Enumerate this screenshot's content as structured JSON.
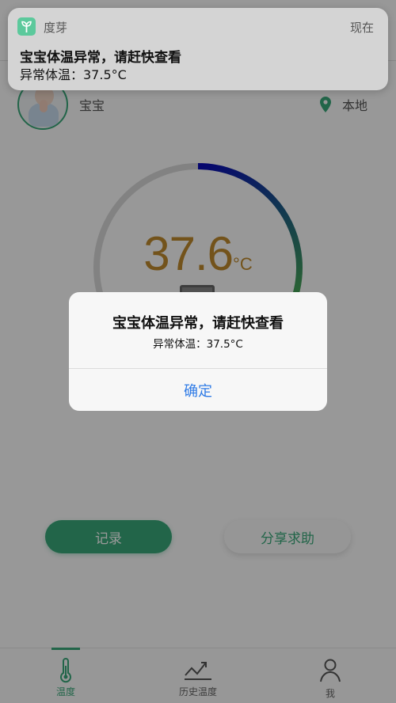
{
  "notification": {
    "app_name": "度芽",
    "app_icon": "sprout-icon",
    "time": "现在",
    "title": "宝宝体温异常，请赶快查看",
    "body": "异常体温：37.5°C"
  },
  "profile": {
    "name": "宝宝",
    "location_icon": "location-pin-icon",
    "location": "本地"
  },
  "gauge": {
    "temperature": "37.6",
    "unit": "°C",
    "arc_fraction": 0.38,
    "colors": {
      "track": "#d9d9d9",
      "start": "#0a0ab8",
      "mid": "#1d5c86",
      "end": "#4caf50"
    }
  },
  "actions": {
    "record_label": "记录",
    "share_label": "分享求助"
  },
  "alert": {
    "title": "宝宝体温异常，请赶快查看",
    "message": "异常体温：37.5°C",
    "confirm_label": "确定"
  },
  "tabbar": {
    "items": [
      {
        "label": "温度",
        "icon": "thermometer-icon",
        "active": true
      },
      {
        "label": "历史温度",
        "icon": "trend-chart-icon",
        "active": false
      },
      {
        "label": "我",
        "icon": "person-icon",
        "active": false
      }
    ]
  },
  "colors": {
    "brand_green": "#3aa97a",
    "temperature_text": "#c08a2e",
    "alert_link_blue": "#2f7be6"
  }
}
